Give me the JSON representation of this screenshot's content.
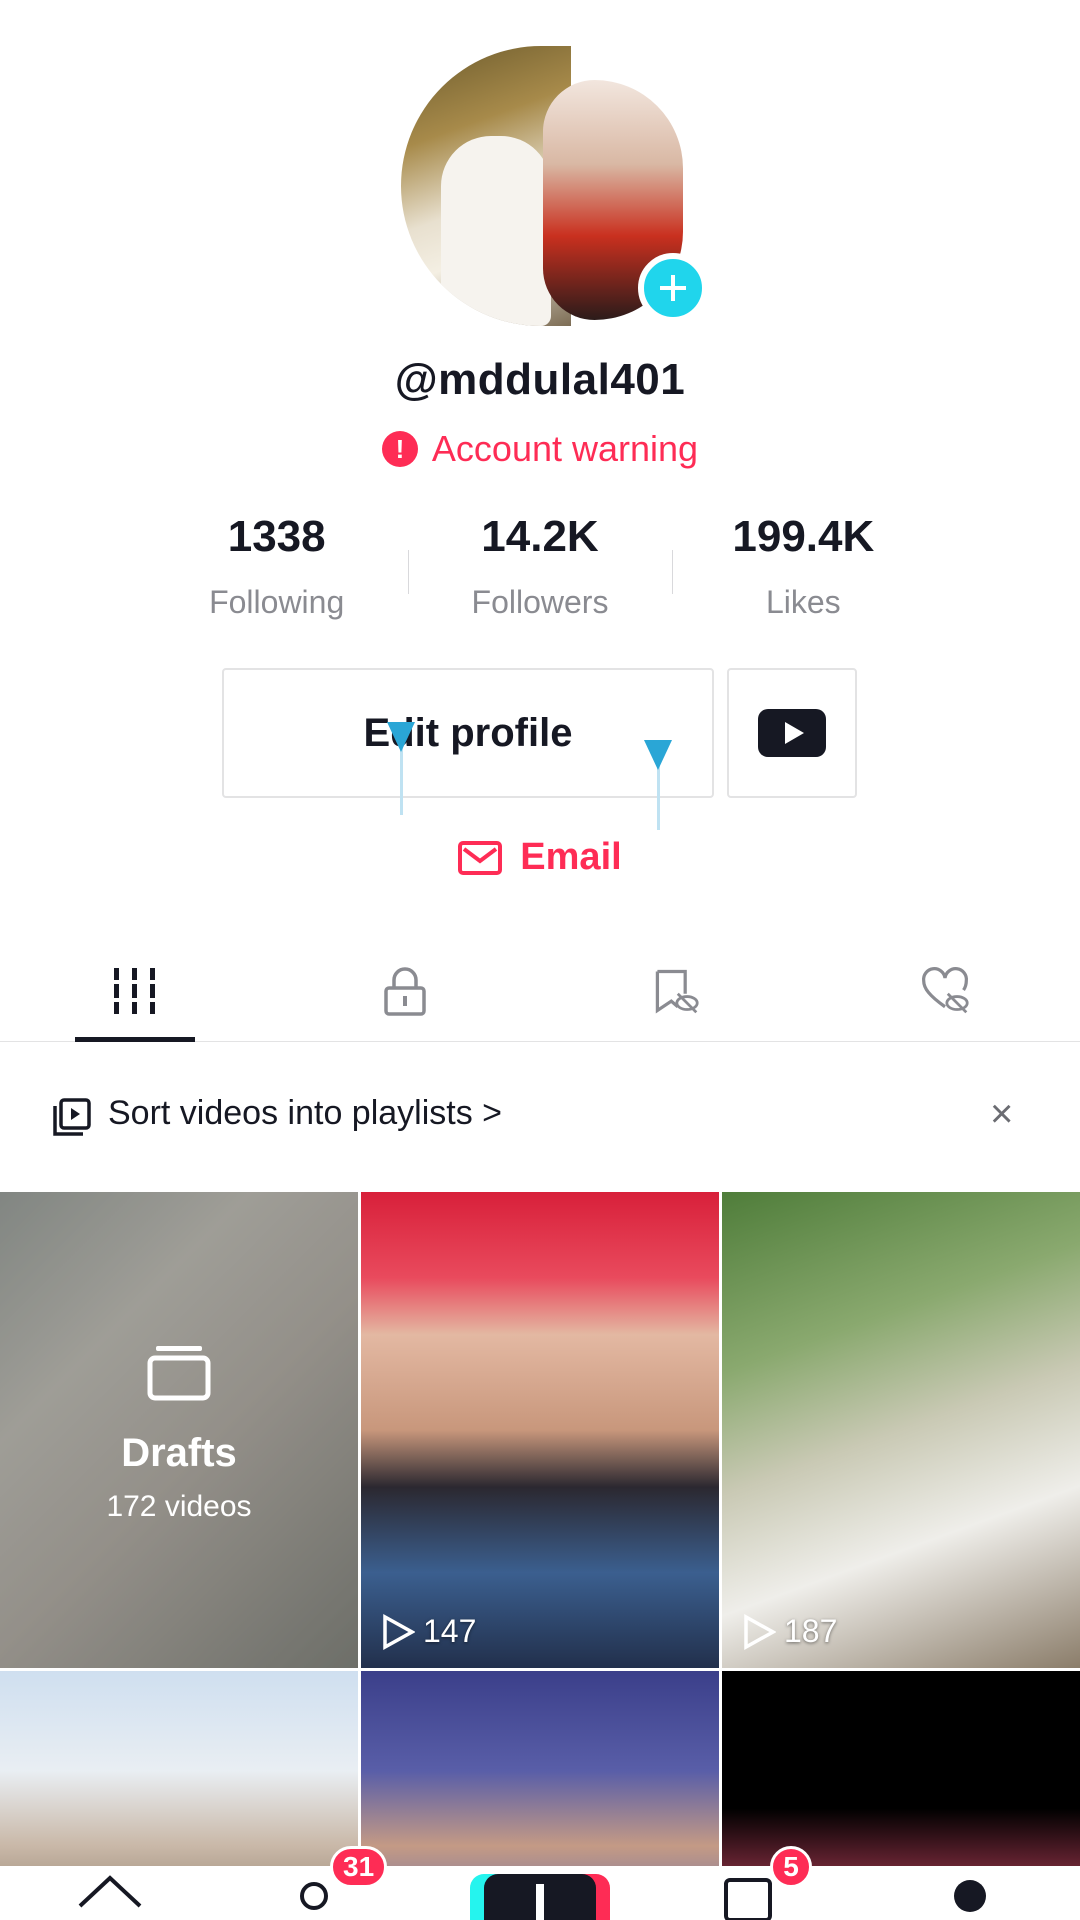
{
  "profile": {
    "username": "@mddulal401",
    "warning_text": "Account warning",
    "stats": [
      {
        "value": "1338",
        "label": "Following"
      },
      {
        "value": "14.2K",
        "label": "Followers"
      },
      {
        "value": "199.4K",
        "label": "Likes"
      }
    ],
    "edit_profile_label": "Edit profile",
    "email_label": "Email"
  },
  "tabs": [
    {
      "icon": "grid-icon",
      "active": true
    },
    {
      "icon": "lock-icon",
      "active": false
    },
    {
      "icon": "bookmark-hidden-icon",
      "active": false
    },
    {
      "icon": "heart-hidden-icon",
      "active": false
    }
  ],
  "playlist_banner": {
    "text": "Sort videos into playlists >",
    "close": "×"
  },
  "grid": {
    "drafts": {
      "title": "Drafts",
      "count": "172 videos"
    },
    "videos": [
      {
        "views": "147"
      },
      {
        "views": "187"
      }
    ]
  },
  "bottom_nav": {
    "friends_badge": "31",
    "inbox_badge": "5"
  },
  "colors": {
    "accent": "#fe2c55",
    "teal": "#20d5ec",
    "text_primary": "#161823",
    "text_secondary": "#8a8b91"
  }
}
